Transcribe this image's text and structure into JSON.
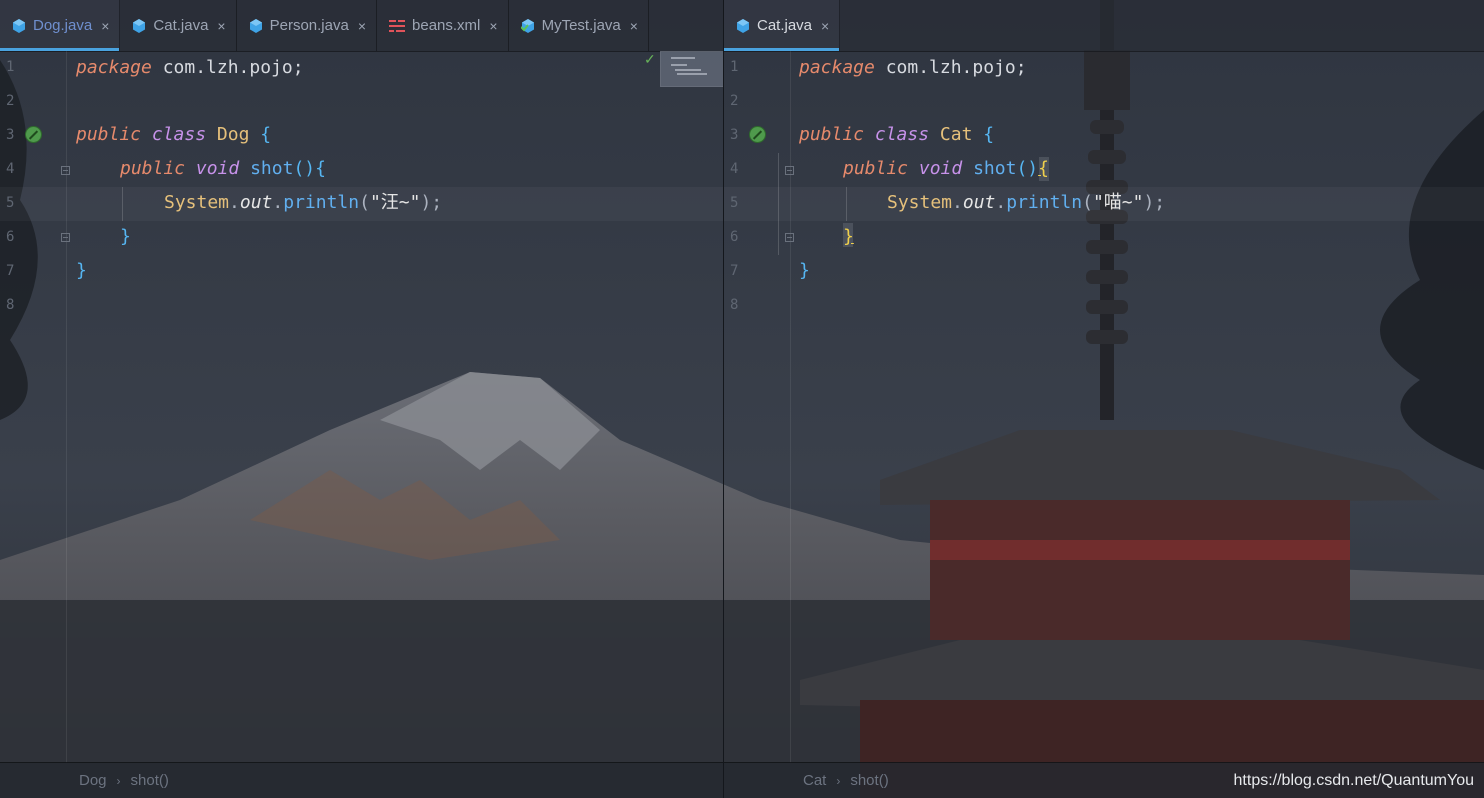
{
  "colors": {
    "accent": "#4aa3df",
    "keyword": "#e68a6c",
    "class_name": "#e5c07b",
    "function": "#61afef",
    "brace": "#56b6f2"
  },
  "left_editor": {
    "tabs": [
      {
        "label": "Dog.java",
        "icon": "java-class-icon",
        "active": true
      },
      {
        "label": "Cat.java",
        "icon": "java-class-icon",
        "active": false
      },
      {
        "label": "Person.java",
        "icon": "java-class-icon",
        "active": false
      },
      {
        "label": "beans.xml",
        "icon": "xml-file-icon",
        "active": false
      },
      {
        "label": "MyTest.java",
        "icon": "java-test-class-icon",
        "active": false
      }
    ],
    "close_glyph": "×",
    "line_numbers": [
      "1",
      "2",
      "3",
      "4",
      "5",
      "6",
      "7",
      "8"
    ],
    "code": {
      "l1_kw": "package",
      "l1_rest": " com.lzh.pojo;",
      "l3_kw1": "public",
      "l3_kw2": "class",
      "l3_cls": "Dog",
      "l3_brace": "{",
      "l4_kw1": "public",
      "l4_kw2": "void",
      "l4_fn": "shot",
      "l4_paren": "()",
      "l4_brace": "{",
      "l5_sys": "System",
      "l5_dot1": ".",
      "l5_out": "out",
      "l5_dot2": ".",
      "l5_fn": "println",
      "l5_open": "(",
      "l5_str": "\"汪~\"",
      "l5_close": ");",
      "l6_brace": "}",
      "l7_brace": "}"
    },
    "breadcrumb": [
      "Dog",
      "shot()"
    ]
  },
  "right_editor": {
    "tabs": [
      {
        "label": "Cat.java",
        "icon": "java-class-icon",
        "active": true
      }
    ],
    "close_glyph": "×",
    "line_numbers": [
      "1",
      "2",
      "3",
      "4",
      "5",
      "6",
      "7",
      "8"
    ],
    "code": {
      "l1_kw": "package",
      "l1_rest": " com.lzh.pojo;",
      "l3_kw1": "public",
      "l3_kw2": "class",
      "l3_cls": "Cat",
      "l3_brace": "{",
      "l4_kw1": "public",
      "l4_kw2": "void",
      "l4_fn": "shot",
      "l4_paren": "()",
      "l4_brace": "{",
      "l5_sys": "System",
      "l5_dot1": ".",
      "l5_out": "out",
      "l5_dot2": ".",
      "l5_fn": "println",
      "l5_open": "(",
      "l5_str": "\"喵~\"",
      "l5_close": ");",
      "l6_brace": "}",
      "l7_brace": "}"
    },
    "breadcrumb": [
      "Cat",
      "shot()"
    ]
  },
  "watermark": "https://blog.csdn.net/QuantumYou"
}
